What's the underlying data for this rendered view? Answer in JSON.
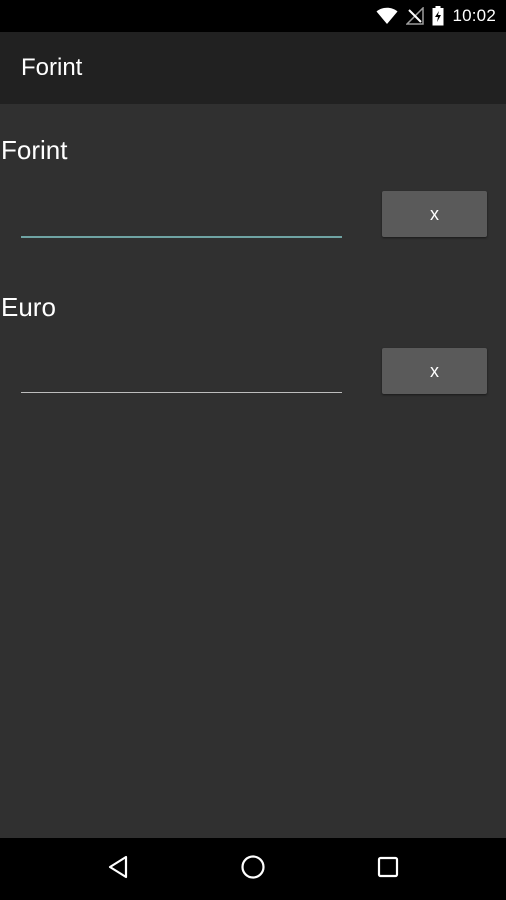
{
  "status_bar": {
    "time": "10:02",
    "icons": [
      "wifi-icon",
      "no-signal-icon",
      "battery-charging-icon"
    ]
  },
  "action_bar": {
    "title": "Forint"
  },
  "forint": {
    "label": "Forint",
    "value": "",
    "clear_label": "x"
  },
  "euro": {
    "label": "Euro",
    "value": "",
    "clear_label": "x"
  },
  "nav_bar": {
    "icons": [
      "back-icon",
      "home-icon",
      "recents-icon"
    ]
  },
  "colors": {
    "background": "#303030",
    "action_bar": "#212121",
    "focus_underline": "#6fa3a3",
    "button": "#5a5a5a"
  }
}
